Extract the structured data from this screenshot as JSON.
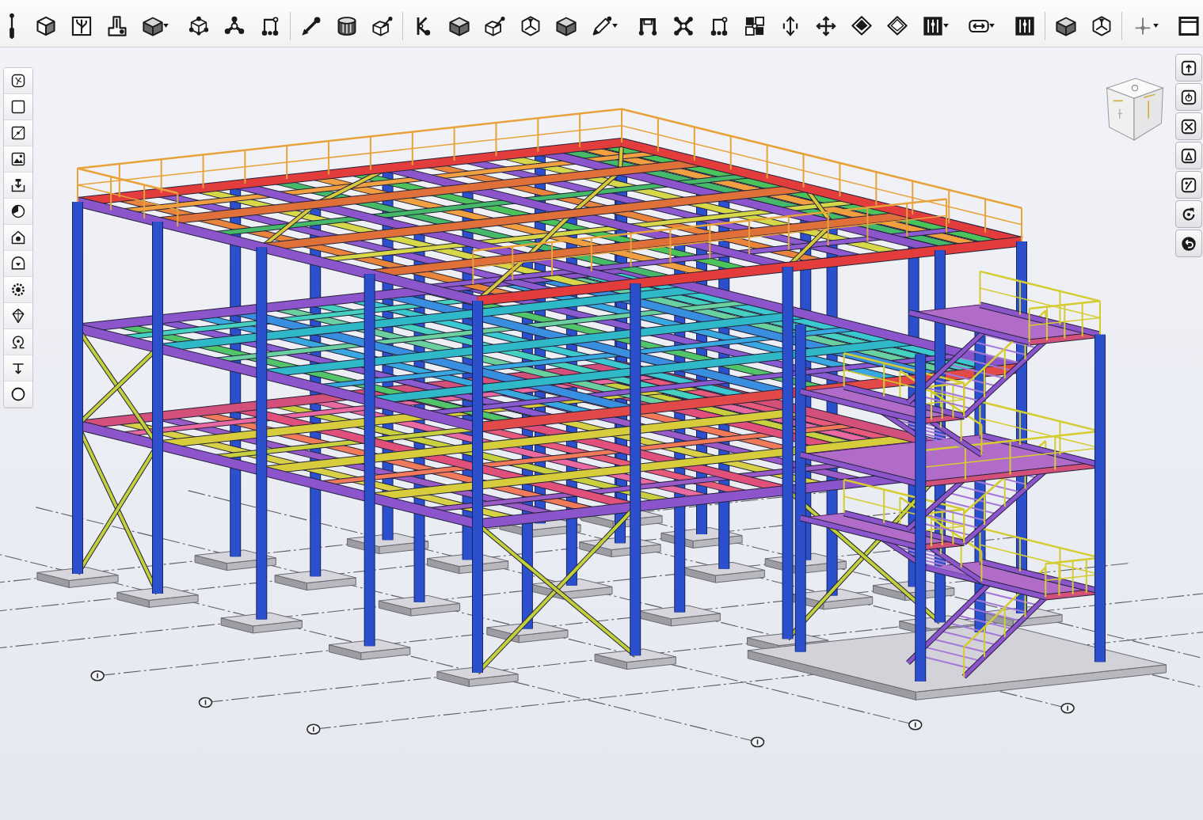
{
  "top_toolbar": {
    "items": [
      {
        "kind": "handle"
      },
      {
        "kind": "tool",
        "menu": false
      },
      {
        "kind": "tool",
        "menu": false
      },
      {
        "kind": "tool",
        "menu": false
      },
      {
        "kind": "tool",
        "menu": true
      },
      {
        "kind": "tool",
        "menu": false
      },
      {
        "kind": "tool",
        "menu": false
      },
      {
        "kind": "tool",
        "menu": false
      },
      {
        "kind": "separator"
      },
      {
        "kind": "tool",
        "menu": false
      },
      {
        "kind": "tool",
        "menu": false
      },
      {
        "kind": "tool",
        "menu": false
      },
      {
        "kind": "separator"
      },
      {
        "kind": "tool",
        "menu": false
      },
      {
        "kind": "tool",
        "menu": false
      },
      {
        "kind": "tool",
        "menu": false
      },
      {
        "kind": "tool",
        "menu": false
      },
      {
        "kind": "tool",
        "menu": false
      },
      {
        "kind": "tool",
        "menu": true
      },
      {
        "kind": "tool",
        "menu": false
      },
      {
        "kind": "tool",
        "menu": false
      },
      {
        "kind": "tool",
        "menu": false
      },
      {
        "kind": "tool",
        "menu": false
      },
      {
        "kind": "tool",
        "menu": false
      },
      {
        "kind": "tool",
        "menu": false
      },
      {
        "kind": "tool",
        "menu": false
      },
      {
        "kind": "tool",
        "menu": false
      },
      {
        "kind": "tool",
        "menu": true
      },
      {
        "kind": "tool",
        "menu": true
      },
      {
        "kind": "tool",
        "menu": false
      },
      {
        "kind": "separator"
      },
      {
        "kind": "tool",
        "menu": false
      },
      {
        "kind": "tool",
        "menu": false
      },
      {
        "kind": "separator"
      },
      {
        "kind": "tool",
        "menu": true
      },
      {
        "kind": "tool",
        "menu": false
      }
    ]
  },
  "left_toolbar": {
    "items": [
      {
        "kind": "tool"
      },
      {
        "kind": "tool"
      },
      {
        "kind": "tool"
      },
      {
        "kind": "tool"
      },
      {
        "kind": "tool"
      },
      {
        "kind": "tool"
      },
      {
        "kind": "tool"
      },
      {
        "kind": "tool"
      },
      {
        "kind": "tool"
      },
      {
        "kind": "tool"
      },
      {
        "kind": "tool"
      },
      {
        "kind": "tool"
      },
      {
        "kind": "tool"
      }
    ]
  },
  "right_toolbar": {
    "items": [
      {
        "kind": "tool"
      },
      {
        "kind": "tool"
      },
      {
        "kind": "tool"
      },
      {
        "kind": "tool"
      },
      {
        "kind": "tool"
      },
      {
        "kind": "tool"
      },
      {
        "kind": "tool"
      }
    ]
  }
}
